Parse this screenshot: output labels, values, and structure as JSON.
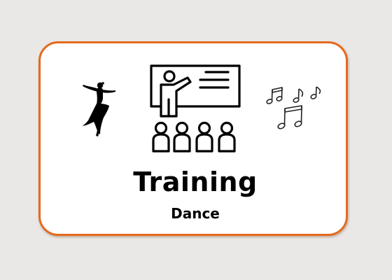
{
  "card": {
    "title": "Training",
    "subtitle": "Dance",
    "border_color": "#e46a1f",
    "background_color": "#ffffff"
  },
  "page": {
    "background_color": "#e9e8e6"
  },
  "icons": {
    "left": "dancer-icon",
    "center": "classroom-teacher-icon",
    "right": "music-notes-icon"
  }
}
